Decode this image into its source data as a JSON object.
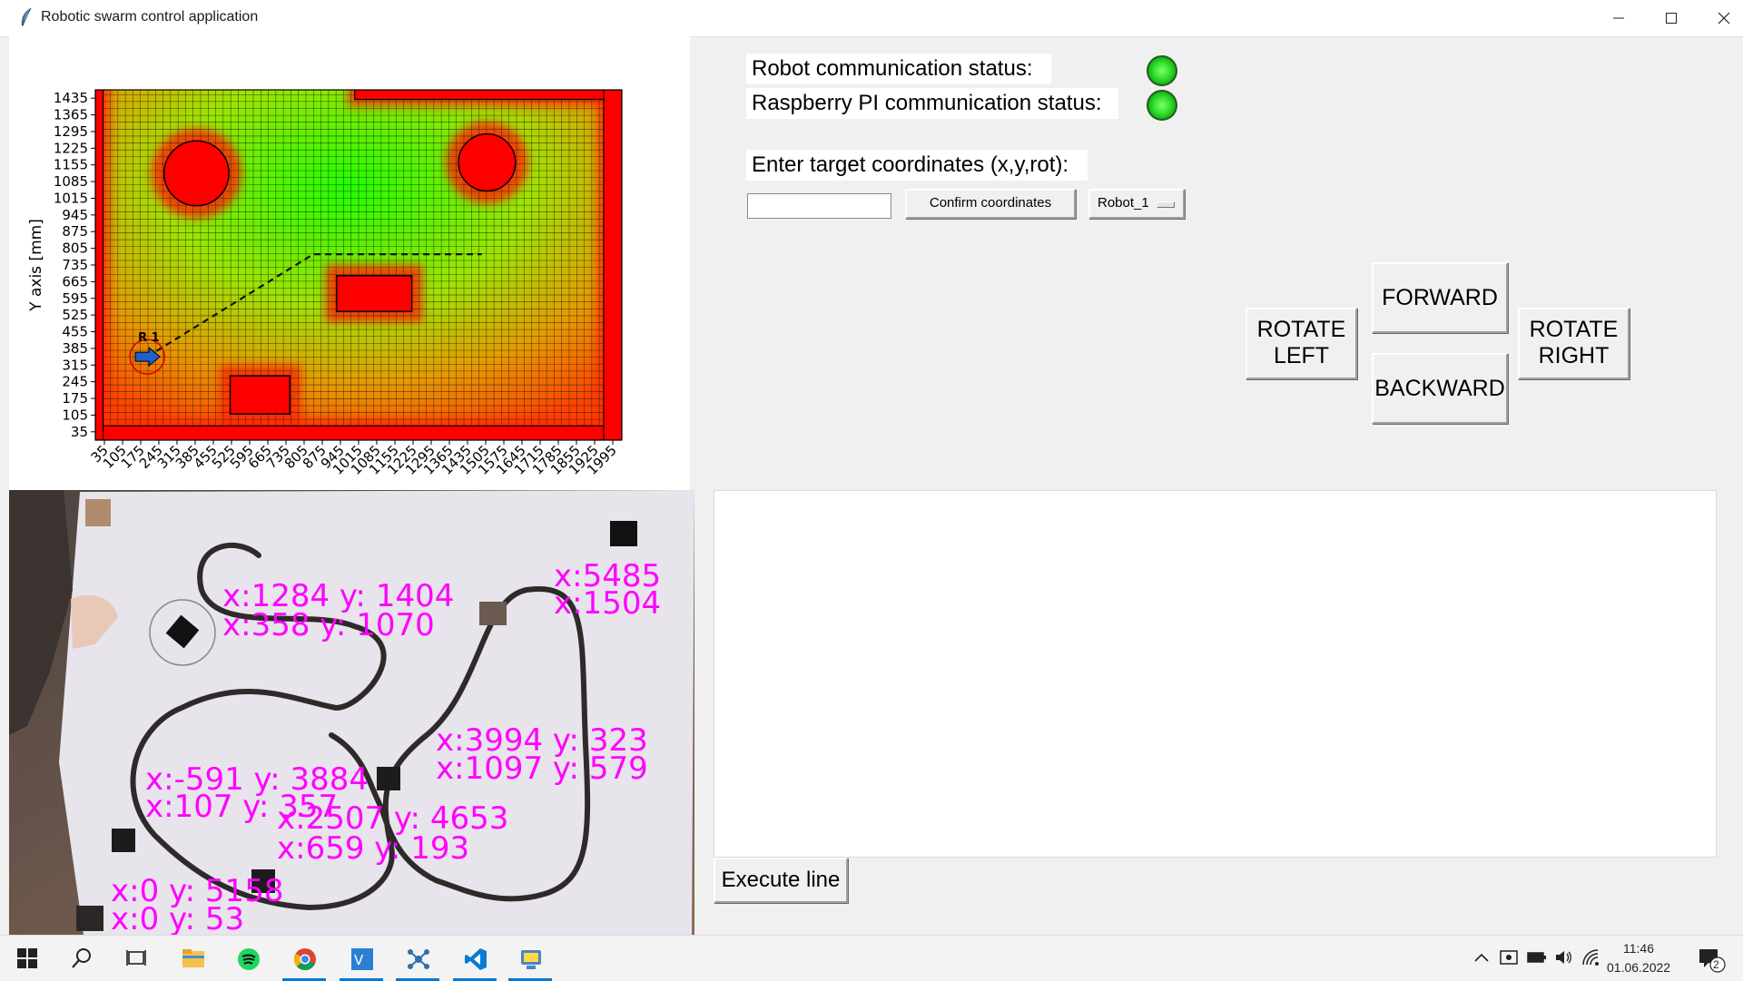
{
  "window": {
    "title": "Robotic swarm control application",
    "accent": "#0078d7"
  },
  "status": {
    "robot_label": "Robot communication status:",
    "raspberry_label": "Raspberry PI communication status:",
    "led_color": "#2fe02a"
  },
  "target": {
    "label": "Enter target coordinates (x,y,rot):",
    "input_value": "",
    "confirm_label": "Confirm coordinates",
    "robot_selected": "Robot_1"
  },
  "controls": {
    "forward": "FORWARD",
    "backward": "BACKWARD",
    "rotate_left": "ROTATE LEFT",
    "rotate_right": "ROTATE RIGHT"
  },
  "console": {
    "text": "",
    "execute_label": "Execute line"
  },
  "chart_data": {
    "type": "heatmap",
    "ylabel": "Y axis [mm]",
    "xlabel": "",
    "x_ticks": [
      "35",
      "105",
      "175",
      "245",
      "315",
      "385",
      "455",
      "525",
      "595",
      "665",
      "735",
      "805",
      "875",
      "945",
      "1015",
      "1085",
      "1155",
      "1225",
      "1295",
      "1365",
      "1435",
      "1505",
      "1575",
      "1645",
      "1715",
      "1785",
      "1855",
      "1925",
      "1995"
    ],
    "y_ticks": [
      "1435",
      "1365",
      "1295",
      "1225",
      "1155",
      "1085",
      "1015",
      "945",
      "875",
      "805",
      "735",
      "665",
      "595",
      "525",
      "455",
      "385",
      "315",
      "245",
      "175",
      "105",
      "35"
    ],
    "xlim": [
      0,
      2030
    ],
    "ylim": [
      0,
      1470
    ],
    "grid": true,
    "colormap": [
      "#ff0000",
      "#ffff00",
      "#00ff00"
    ],
    "obstacles": [
      {
        "shape": "circle",
        "cx": 390,
        "cy": 1120,
        "r": 125
      },
      {
        "shape": "circle",
        "cx": 1510,
        "cy": 1165,
        "r": 110
      },
      {
        "shape": "rect",
        "x0": 930,
        "y0": 540,
        "x1": 1220,
        "y1": 690
      },
      {
        "shape": "rect",
        "x0": 520,
        "y0": 110,
        "x1": 750,
        "y1": 270
      },
      {
        "shape": "wall",
        "x0": 1000,
        "y0": 1430,
        "x1": 2030,
        "y1": 1470
      },
      {
        "shape": "wall",
        "x0": 0,
        "y0": 0,
        "x1": 2030,
        "y1": 60
      },
      {
        "shape": "wall",
        "x0": 0,
        "y0": 0,
        "x1": 30,
        "y1": 1470
      },
      {
        "shape": "wall",
        "x0": 1960,
        "y0": 0,
        "x1": 2030,
        "y1": 1470
      }
    ],
    "path": [
      [
        200,
        350
      ],
      [
        840,
        780
      ],
      [
        1490,
        780
      ]
    ],
    "robot": {
      "label": "R 1",
      "x": 200,
      "y": 350,
      "rot": 0
    }
  },
  "camera": {
    "overlays": [
      "x:1284  y: 1404",
      "x:358  y: 1070",
      "x:5485",
      "x:1504",
      "x:3994  y: 323",
      "x:1097  y: 579",
      "x:-591  y: 3884",
      "x:107  y: 357",
      "x:2507  y: 4653",
      "x:659  y: 193",
      "x:0  y: 5158",
      "x:0  y: 53"
    ],
    "overlay_color": "#ff00ff"
  },
  "taskbar": {
    "time": "11:46",
    "date": "01.06.2022",
    "notifications": "2",
    "apps": [
      "start-icon",
      "search-icon",
      "task-view-icon",
      "file-explorer-icon",
      "spotify-icon",
      "chrome-icon",
      "vc-icon",
      "network-app-icon",
      "vscode-icon",
      "python-icon"
    ]
  }
}
